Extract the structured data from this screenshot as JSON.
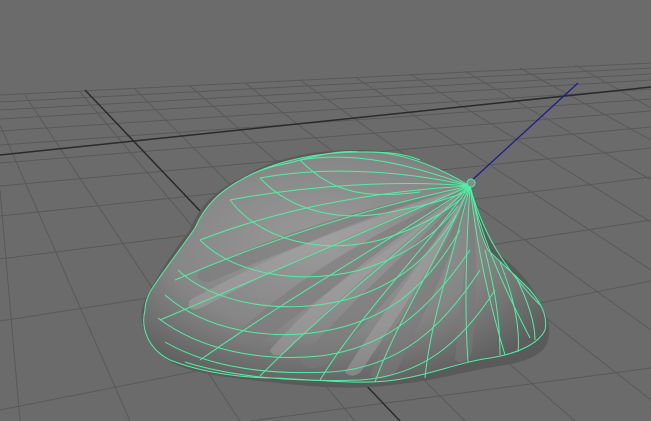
{
  "viewport": {
    "background_color": "#6b6b6b",
    "grid_color": "#5a5a5a",
    "grid_axis_color": "#262626",
    "object": {
      "description_name": "shell-object",
      "surface_color": "#8a8a8a",
      "wireframe_color": "#4ef0a4",
      "selected": true
    },
    "pivot_manipulator_color": "#1d1d90"
  }
}
